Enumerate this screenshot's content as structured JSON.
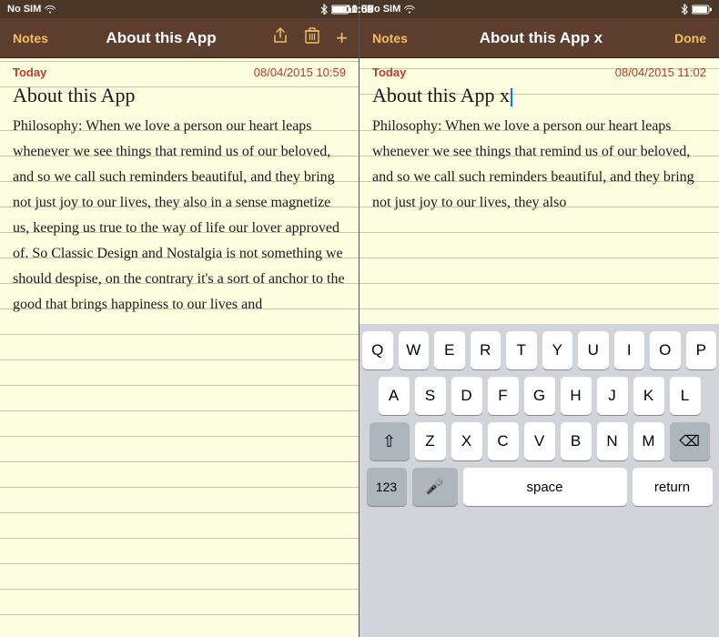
{
  "panels": [
    {
      "id": "left",
      "statusBar": {
        "carrier": "No SIM",
        "time": "10:59",
        "batteryFull": true
      },
      "navBar": {
        "backLabel": "Notes",
        "title": "About this App",
        "hasShare": true,
        "hasTrash": true,
        "hasAdd": true,
        "hasDone": false
      },
      "note": {
        "dateLabel": "Today",
        "dateValue": "08/04/2015 10:59",
        "title": "About this App",
        "body": "Philosophy: When we love a person our heart leaps whenever we see things that remind us of our beloved, and so we call such reminders beautiful, and they bring not just joy to our lives, they also in a sense magnetize us, keeping us true to the way of life our lover approved of. So Classic Design and Nostalgia is not something we should despise, on the contrary it's a sort of anchor to the good that brings happiness to our lives and"
      },
      "hasKeyboard": false
    },
    {
      "id": "right",
      "statusBar": {
        "carrier": "No SIM",
        "time": "11:02",
        "batteryFull": true
      },
      "navBar": {
        "backLabel": "Notes",
        "title": "About this App x",
        "hasShare": false,
        "hasTrash": false,
        "hasAdd": false,
        "hasDone": true,
        "doneLabel": "Done"
      },
      "note": {
        "dateLabel": "Today",
        "dateValue": "08/04/2015 11:02",
        "title": "About this App x",
        "body": "Philosophy: When we love a person our heart leaps whenever we see things that remind us of our beloved, and so we call such reminders beautiful, and they bring not just joy to our lives, they also"
      },
      "hasKeyboard": true,
      "keyboard": {
        "rows": [
          [
            "Q",
            "W",
            "E",
            "R",
            "T",
            "Y",
            "U",
            "I",
            "O",
            "P"
          ],
          [
            "A",
            "S",
            "D",
            "F",
            "G",
            "H",
            "J",
            "K",
            "L"
          ],
          [
            "Z",
            "X",
            "C",
            "V",
            "B",
            "N",
            "M"
          ]
        ],
        "bottomRow": {
          "numLabel": "123",
          "micLabel": "🎤",
          "spaceLabel": "space",
          "returnLabel": "return"
        }
      }
    }
  ]
}
